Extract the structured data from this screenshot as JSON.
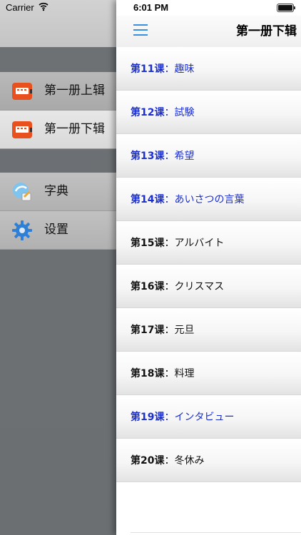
{
  "drawer": {
    "status": {
      "carrier": "Carrier"
    },
    "book_items": [
      {
        "label": "第一册上辑",
        "icon": "book-icon",
        "selected": false
      },
      {
        "label": "第一册下辑",
        "icon": "book-icon",
        "selected": true
      }
    ],
    "tool_items": [
      {
        "label": "字典",
        "icon": "dictionary-icon"
      },
      {
        "label": "设置",
        "icon": "gear-icon"
      }
    ]
  },
  "main": {
    "status": {
      "time": "6:01 PM",
      "battery_level": 1.0
    },
    "nav": {
      "title": "第一册下辑",
      "menu_icon": "hamburger-icon"
    },
    "lessons": [
      {
        "number": "第11课",
        "sep": "：",
        "title": "趣味",
        "state": "done"
      },
      {
        "number": "第12课",
        "sep": "：",
        "title": "試験",
        "state": "done"
      },
      {
        "number": "第13课",
        "sep": "：",
        "title": "希望",
        "state": "done"
      },
      {
        "number": "第14课",
        "sep": "：",
        "title": "あいさつの言葉",
        "state": "done"
      },
      {
        "number": "第15课",
        "sep": "：",
        "title": "アルバイト",
        "state": "todo"
      },
      {
        "number": "第16课",
        "sep": "：",
        "title": "クリスマス",
        "state": "todo"
      },
      {
        "number": "第17课",
        "sep": "：",
        "title": "元旦",
        "state": "todo"
      },
      {
        "number": "第18课",
        "sep": "：",
        "title": "料理",
        "state": "todo"
      },
      {
        "number": "第19课",
        "sep": "：",
        "title": "インタビュー",
        "state": "done"
      },
      {
        "number": "第20课",
        "sep": "：",
        "title": "冬休み",
        "state": "todo"
      }
    ]
  },
  "colors": {
    "done_text": "#1b2fd0",
    "todo_text": "#111111",
    "accent": "#3a8fe0",
    "book_icon": "#e8501e"
  }
}
